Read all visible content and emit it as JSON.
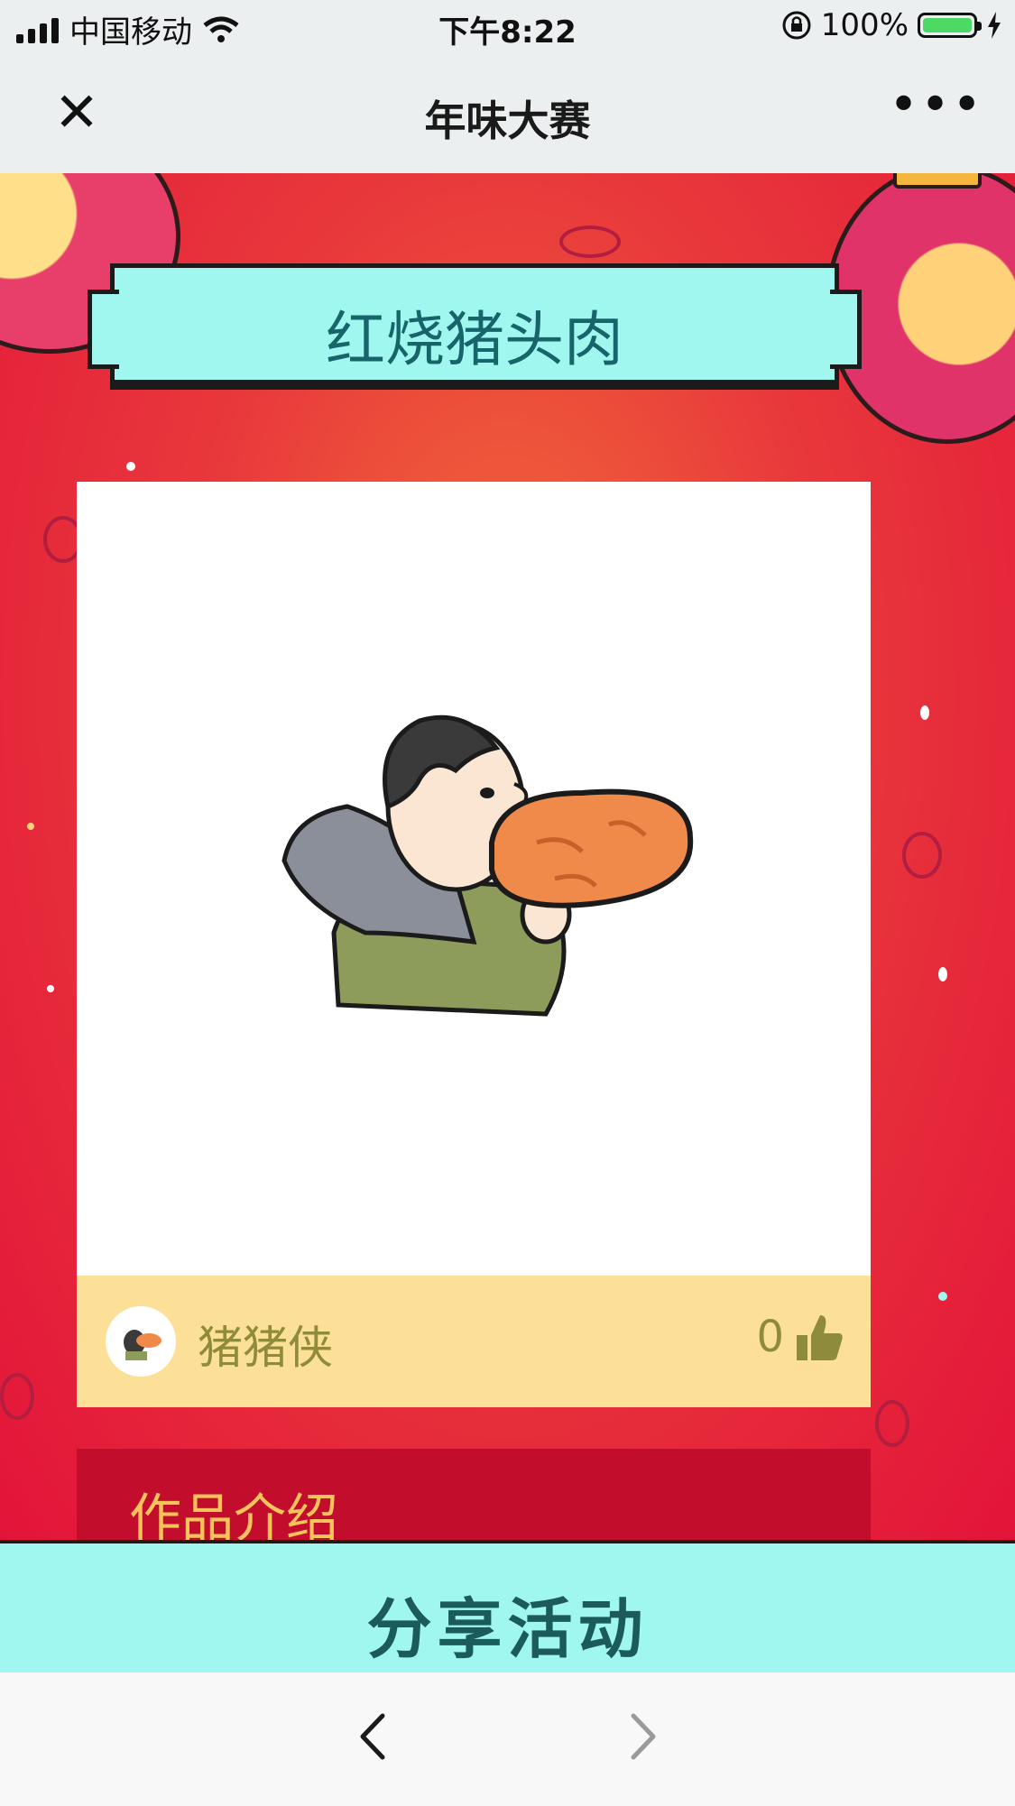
{
  "status_bar": {
    "carrier": "中国移动",
    "time": "下午8:22",
    "battery_percent": "100%",
    "battery_level": 1.0
  },
  "nav": {
    "title": "年味大赛",
    "close_icon": "close-icon",
    "more_icon": "more-icon"
  },
  "entry": {
    "title": "红烧猪头肉",
    "author": "猪猪侠",
    "like_count": "0",
    "intro_heading": "作品介绍"
  },
  "share": {
    "label": "分享活动"
  },
  "colors": {
    "banner": "#9ff7ef",
    "banner_text": "#17646a",
    "author_bar": "#fde097",
    "author_text": "#8e8b3a",
    "intro_bg": "#c20d2c",
    "intro_text": "#f9c35c",
    "background": "#e3143a"
  }
}
